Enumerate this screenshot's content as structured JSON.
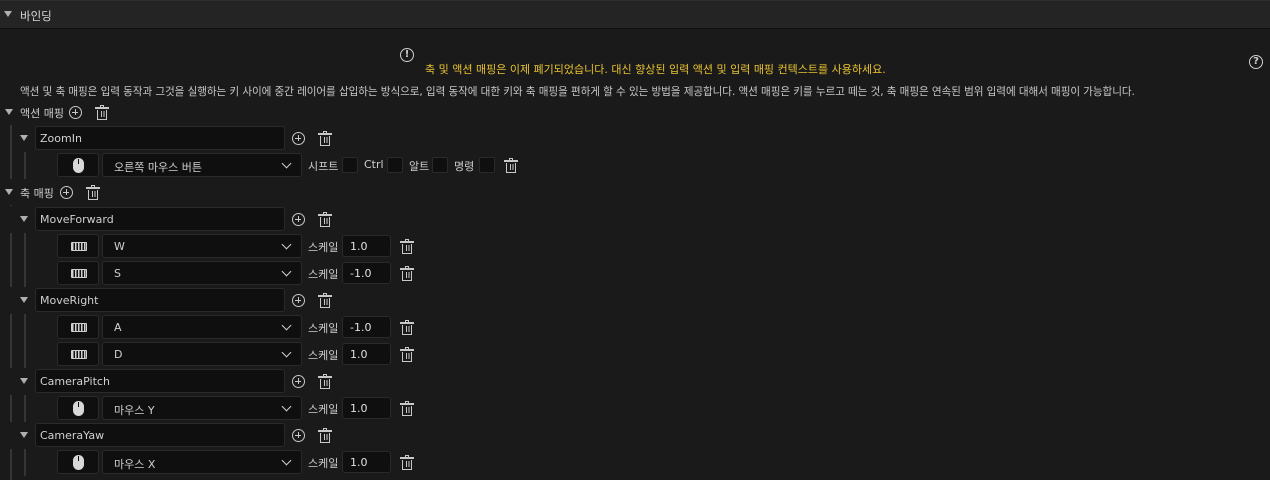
{
  "section": {
    "title": "바인딩"
  },
  "deprecation_notice": "축 및 액션 매핑은 이제 폐기되었습니다. 대신 향상된 입력 액션 및 입력 매핑 컨텍스트를 사용하세요.",
  "description": "액션 및 축 매핑은 입력 동작과 그것을 실행하는 키 사이에 중간 레이어를 삽입하는 방식으로, 입력 동작에 대한 키와 축 매핑을 편하게 할 수 있는 방법을 제공합니다. 액션 매핑은 키를 누르고 떼는 것, 축 매핑은 연속된 범위 입력에 대해서 매핑이 가능합니다.",
  "action_mappings": {
    "label": "액션 매핑",
    "items": [
      {
        "name": "ZoomIn",
        "keys": [
          {
            "icon": "mouse-icon",
            "key": "오른쪽 마우스 버튼"
          }
        ]
      }
    ],
    "modifiers": {
      "shift": "시프트",
      "ctrl": "Ctrl",
      "alt": "알트",
      "cmd": "명령"
    }
  },
  "axis_mappings": {
    "label": "축 매핑",
    "scale_label": "스케일",
    "items": [
      {
        "name": "MoveForward",
        "keys": [
          {
            "icon": "keyboard-icon",
            "key": "W",
            "scale": "1.0"
          },
          {
            "icon": "keyboard-icon",
            "key": "S",
            "scale": "-1.0"
          }
        ]
      },
      {
        "name": "MoveRight",
        "keys": [
          {
            "icon": "keyboard-icon",
            "key": "A",
            "scale": "-1.0"
          },
          {
            "icon": "keyboard-icon",
            "key": "D",
            "scale": "1.0"
          }
        ]
      },
      {
        "name": "CameraPitch",
        "keys": [
          {
            "icon": "mouse-icon",
            "key": "마우스 Y",
            "scale": "1.0"
          }
        ]
      },
      {
        "name": "CameraYaw",
        "keys": [
          {
            "icon": "mouse-icon",
            "key": "마우스 X",
            "scale": "1.0"
          }
        ]
      }
    ]
  }
}
